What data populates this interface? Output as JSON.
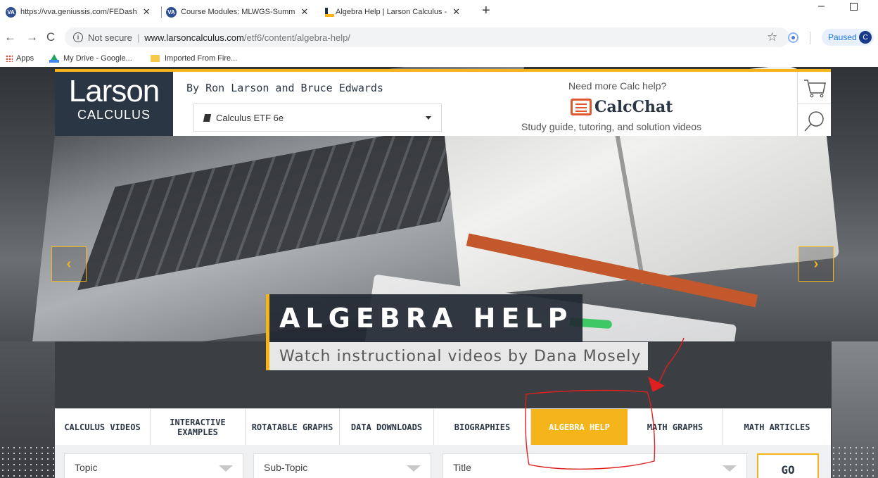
{
  "browser": {
    "tabs": [
      {
        "title": "https://vva.geniussis.com/FEDash",
        "icon": "va-icon"
      },
      {
        "title": "Course Modules: MLWGS-Summ",
        "icon": "va-icon"
      },
      {
        "title": "Algebra Help | Larson Calculus - ",
        "icon": "larson-icon"
      }
    ],
    "new_tab": "+",
    "address": {
      "security": "Not secure",
      "host": "www.larsoncalculus.com",
      "path": "/etf6/content/algebra-help/"
    },
    "profile": {
      "label": "Paused",
      "initial": "C"
    },
    "bookmarks": [
      {
        "label": "Apps",
        "icon": "apps-grid-icon"
      },
      {
        "label": "My Drive - Google...",
        "icon": "google-drive-icon"
      },
      {
        "label": "Imported From Fire...",
        "icon": "folder-icon"
      }
    ]
  },
  "header": {
    "logo_top": "Larson",
    "logo_bottom": "CALCULUS",
    "byline": "By Ron Larson and Bruce Edwards",
    "book_select": "Calculus ETF 6e",
    "calc_need": "Need more Calc help?",
    "calcchat": "CalcChat",
    "calc_sub": "Study guide, tutoring, and solution videos"
  },
  "hero": {
    "title": "ALGEBRA HELP",
    "subtitle": "Watch instructional videos by Dana Mosely",
    "prev": "‹",
    "next": "›"
  },
  "nav": [
    {
      "label": "CALCULUS VIDEOS",
      "active": false
    },
    {
      "label": "INTERACTIVE EXAMPLES",
      "active": false
    },
    {
      "label": "ROTATABLE GRAPHS",
      "active": false
    },
    {
      "label": "DATA DOWNLOADS",
      "active": false
    },
    {
      "label": "BIOGRAPHIES",
      "active": false
    },
    {
      "label": "ALGEBRA HELP",
      "active": true
    },
    {
      "label": "MATH GRAPHS",
      "active": false
    },
    {
      "label": "MATH ARTICLES",
      "active": false
    }
  ],
  "filters": {
    "topic": "Topic",
    "subtopic": "Sub-Topic",
    "title": "Title",
    "go": "GO"
  },
  "colors": {
    "accent": "#f4b41a",
    "navy": "#2b3645",
    "annotation": "#e02020"
  }
}
